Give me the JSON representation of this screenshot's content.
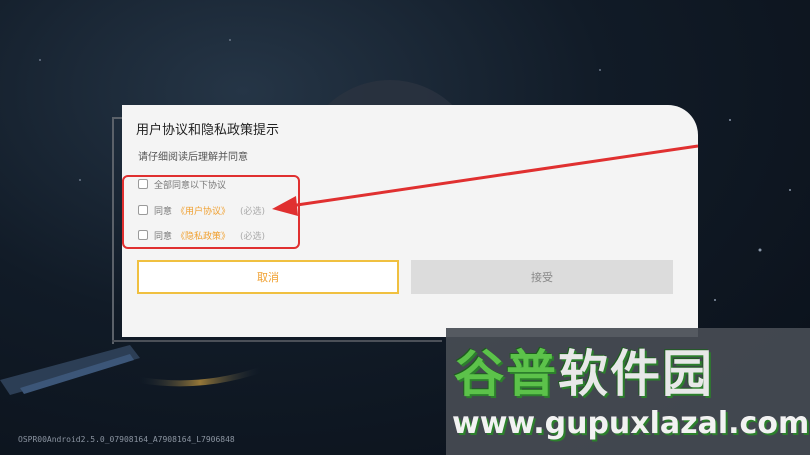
{
  "dialog": {
    "title": "用户协议和隐私政策提示",
    "subtitle": "请仔细阅读后理解并同意",
    "agree_all": "全部同意以下协议",
    "row_user": {
      "prefix": "同意",
      "link": "《用户协议》",
      "required": "(必选)"
    },
    "row_privacy": {
      "prefix": "同意",
      "link": "《隐私政策》",
      "required": "(必选)"
    },
    "cancel_label": "取消",
    "accept_label": "接受"
  },
  "footer": {
    "version": "OSPR00Android2.5.0_07908164_A7908164_L7906848"
  },
  "watermark": {
    "title_part1": "谷普",
    "title_part2": "软件园",
    "url": "www.gupuxlazal.com"
  },
  "colors": {
    "link": "#f0a030",
    "annotation": "#e03030",
    "cancel_border": "#f0c040"
  }
}
